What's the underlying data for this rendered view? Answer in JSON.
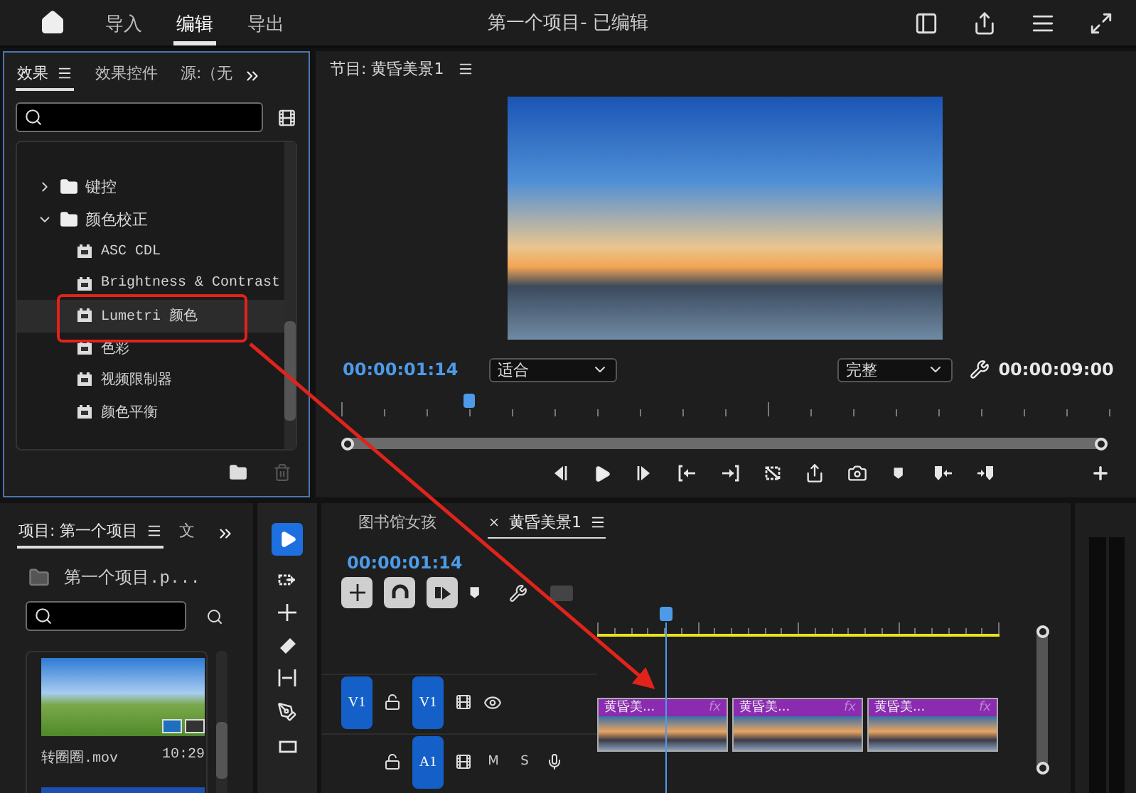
{
  "top_bar": {
    "tabs": [
      {
        "label": "导入",
        "selected": false
      },
      {
        "label": "编辑",
        "selected": true
      },
      {
        "label": "导出",
        "selected": false
      }
    ],
    "title": "第一个项目- 已编辑"
  },
  "effects_panel": {
    "tabs": [
      {
        "label": "效果",
        "selected": true
      },
      {
        "label": "效果控件",
        "selected": false
      },
      {
        "label": "源:（无",
        "selected": false
      }
    ],
    "tree": [
      {
        "label": "键控",
        "expanded": false
      },
      {
        "label": "颜色校正",
        "expanded": true,
        "children": [
          {
            "label": "ASC CDL",
            "selected": false
          },
          {
            "label": "Brightness & Contrast",
            "selected": false
          },
          {
            "label": "Lumetri 颜色",
            "selected": true
          },
          {
            "label": "色彩",
            "selected": false
          },
          {
            "label": "视频限制器",
            "selected": false
          },
          {
            "label": "颜色平衡",
            "selected": false
          }
        ]
      }
    ]
  },
  "program_monitor": {
    "title": "节目: 黄昏美景1",
    "timecode": "00:00:01:14",
    "zoom": "适合",
    "quality": "完整",
    "duration": "00:00:09:00"
  },
  "project_panel": {
    "tabs": [
      {
        "label": "项目: 第一个项目",
        "selected": true
      },
      {
        "label": "文",
        "selected": false
      }
    ],
    "path": "第一个项目.p...",
    "clip": {
      "name": "转圈圈.mov",
      "duration": "10:29"
    }
  },
  "timeline": {
    "tabs": [
      {
        "label": "图书馆女孩",
        "selected": false
      },
      {
        "label": "黄昏美景1",
        "selected": true
      }
    ],
    "timecode": "00:00:01:14",
    "tracks": [
      {
        "kind": "video",
        "source": "V1",
        "name": "V1"
      },
      {
        "kind": "audio",
        "name": "A1",
        "mute": "M",
        "solo": "S"
      }
    ],
    "clips": [
      {
        "label": "黄昏美...",
        "fx": "fx"
      },
      {
        "label": "黄昏美...",
        "fx": "fx"
      },
      {
        "label": "黄昏美...",
        "fx": "fx"
      }
    ]
  }
}
